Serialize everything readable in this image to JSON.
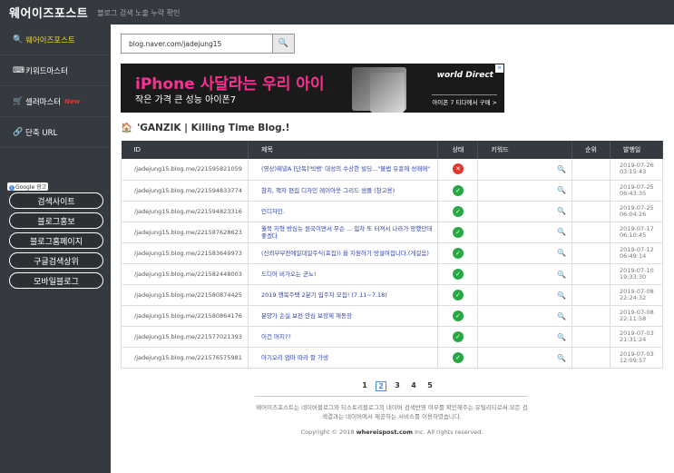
{
  "header": {
    "logo": "웨어이즈포스트",
    "tagline": "블로그 검색 노출 누락 확인"
  },
  "sidebar": {
    "items": [
      {
        "icon": "search-icon",
        "glyph": "🔍",
        "label": "웨어이즈포스트",
        "active": true
      },
      {
        "icon": "keyboard-icon",
        "glyph": "⌨",
        "label": "키워드마스터"
      },
      {
        "icon": "cart-icon",
        "glyph": "🛒",
        "label": "셀러마스터",
        "badge": "New"
      },
      {
        "icon": "link-icon",
        "glyph": "🔗",
        "label": "단축 URL"
      }
    ],
    "ad_label": "Google 광고",
    "ad_links": [
      "검색사이트",
      "블로그홍보",
      "블로그홈페이지",
      "구글검색상위",
      "모바일블로그"
    ]
  },
  "search": {
    "value": "blog.naver.com/jadejung15"
  },
  "ad": {
    "title": "iPhone 사달라는 우리 아이",
    "subtitle": "작은 가격 큰 성능 아이폰7",
    "brand": "world Direct",
    "link": "아이폰 7 티다에서 구매 >"
  },
  "blog_title": "'GANZIK | Killing Time Blog.!",
  "table": {
    "headers": [
      "ID",
      "제목",
      "상태",
      "키워드",
      "순위",
      "발행일"
    ],
    "rows": [
      {
        "id": "/jadejung15.blog.me/221595821059",
        "title": "(영상)웨넬A [단독]'빅뱅' 대성의 수상한 빌딩...\"불법 유흥에 성매매\"",
        "status": "no",
        "date": "2019-07-26 03:15:43"
      },
      {
        "id": "/jadejung15.blog.me/221594833774",
        "title": "참치, 책자 편집 디자인 레이아웃 그리드 샘플 (참고용)",
        "status": "ok",
        "date": "2019-07-25 06:43:35"
      },
      {
        "id": "/jadejung15.blog.me/221594823316",
        "title": "인디자인.",
        "status": "ok",
        "date": "2019-07-25 06:04:26"
      },
      {
        "id": "/jadejung15.blog.me/221587628623",
        "title": "월북 처형 방심뉴 원국이면서 무슨 ... 힘차 또 터져서 나라가 망했단데 좋겠다",
        "status": "ok",
        "date": "2019-07-17 06:10:45"
      },
      {
        "id": "/jadejung15.blog.me/221583649973",
        "title": "(신뢰부부전에일대일주식(포집)) 을 지원하기 망설여집니다.(게걸음)",
        "status": "ok",
        "date": "2019-07-12 06:49:14"
      },
      {
        "id": "/jadejung15.blog.me/221582448003",
        "title": "드디어 비가오는 군뇨!",
        "status": "ok",
        "date": "2019-07-10 19:33:30"
      },
      {
        "id": "/jadejung15.blog.me/221580874425",
        "title": "2019 행복주택 2분기 입주자 모집! (7.11~7.18)",
        "status": "ok",
        "date": "2019-07-08 22:24:32"
      },
      {
        "id": "/jadejung15.blog.me/221580864176",
        "title": "분양가 손실 보전 안심 보장제 재등장",
        "status": "ok",
        "date": "2019-07-08 22:11:58"
      },
      {
        "id": "/jadejung15.blog.me/221577021393",
        "title": "이건 머지??",
        "status": "ok",
        "date": "2019-07-03 21:31:24"
      },
      {
        "id": "/jadejung15.blog.me/221576575981",
        "title": "아기오리 엄마 따라 잘 가넹",
        "status": "ok",
        "date": "2019-07-03 12:09:57"
      }
    ]
  },
  "pagination": {
    "pages": [
      "1",
      "2",
      "3",
      "4",
      "5"
    ],
    "current": "2"
  },
  "footer": {
    "line1": "웨어이즈포스트는 네이버블로그와 티스토리블로그의 네이버 검색반영 여부를 확인해주는 유틸리티로써 모든 검색결과는 네이버에서 제공하는 서비스를 이용하였습니다.",
    "copyright_prefix": "Copyright © 2018",
    "copyright_site": "whereispost.com",
    "copyright_suffix": "Inc. All rights reserved."
  }
}
